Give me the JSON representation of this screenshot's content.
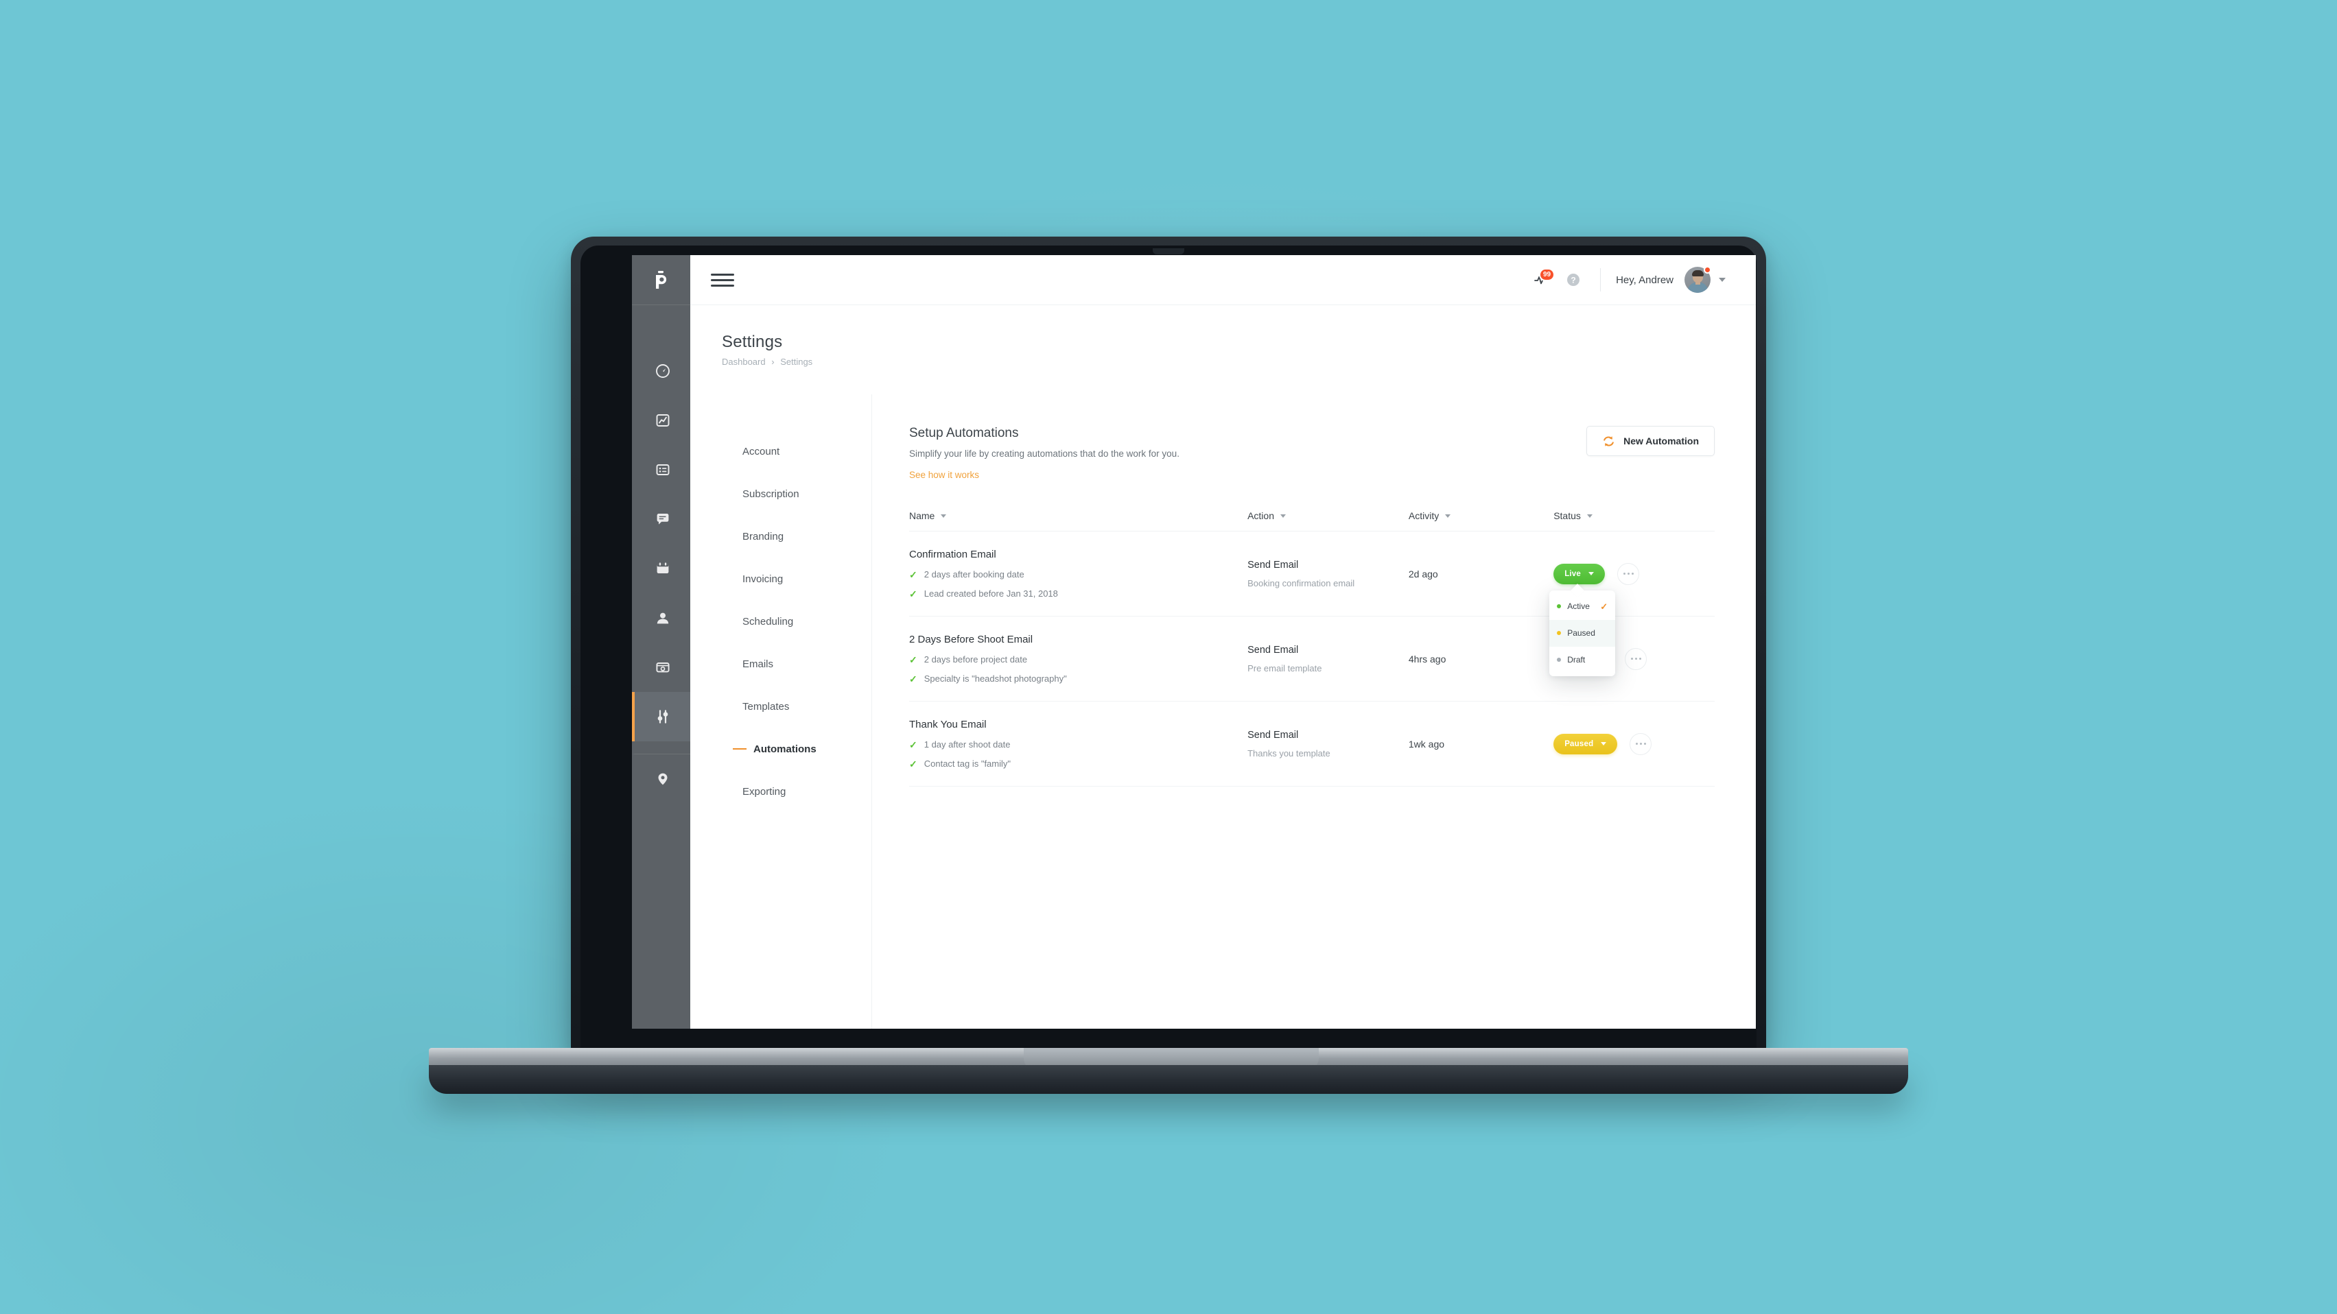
{
  "background_color": "#6EC6D4",
  "accent_color": "#F0912E",
  "app": {
    "rail": {
      "logo_icon": "pixieset-p-logo-icon",
      "items": [
        {
          "icon": "speedometer-icon",
          "name": "dashboard",
          "active": false
        },
        {
          "icon": "line-chart-icon",
          "name": "analytics",
          "active": false
        },
        {
          "icon": "list-checklist-icon",
          "name": "projects",
          "active": false
        },
        {
          "icon": "chat-bubble-icon",
          "name": "messages",
          "active": false
        },
        {
          "icon": "calendar-icon",
          "name": "calendar",
          "active": false
        },
        {
          "icon": "user-contact-icon",
          "name": "contacts",
          "active": false
        },
        {
          "icon": "browser-window-icon",
          "name": "gallery",
          "active": false
        },
        {
          "icon": "sliders-icon",
          "name": "settings",
          "active": true
        },
        {
          "icon": "location-pin-icon",
          "name": "locations",
          "active": false
        }
      ]
    },
    "topbar": {
      "menu_icon": "hamburger-menu-icon",
      "activity_icon": "activity-pulse-icon",
      "notification_count": "99",
      "help_icon": "question-mark-help-icon",
      "greeting": "Hey, Andrew",
      "avatar_icon": "user-avatar",
      "chevron_icon": "chevron-down-icon"
    },
    "page": {
      "title": "Settings",
      "breadcrumb": {
        "root": "Dashboard",
        "separator": "›",
        "current": "Settings"
      }
    },
    "settings_nav": {
      "items": [
        {
          "label": "Account",
          "active": false
        },
        {
          "label": "Subscription",
          "active": false
        },
        {
          "label": "Branding",
          "active": false
        },
        {
          "label": "Invoicing",
          "active": false
        },
        {
          "label": "Scheduling",
          "active": false
        },
        {
          "label": "Emails",
          "active": false
        },
        {
          "label": "Templates",
          "active": false
        },
        {
          "label": "Automations",
          "active": true
        },
        {
          "label": "Exporting",
          "active": false
        }
      ]
    },
    "section": {
      "title": "Setup Automations",
      "subtitle": "Simplify your life by creating automations that do the work for you.",
      "link": "See how it works",
      "new_button": {
        "label": "New Automation",
        "icon": "refresh-cycle-icon",
        "icon_color": "#F0912E"
      }
    },
    "table": {
      "columns": [
        {
          "label": "Name",
          "sort_icon": "caret-down-icon"
        },
        {
          "label": "Action",
          "sort_icon": "caret-down-icon"
        },
        {
          "label": "Activity",
          "sort_icon": "caret-down-icon"
        },
        {
          "label": "Status",
          "sort_icon": "caret-down-icon"
        }
      ],
      "rows": [
        {
          "name": "Confirmation Email",
          "conditions": [
            "2 days after booking date",
            "Lead created before Jan 31, 2018"
          ],
          "action_main": "Send Email",
          "action_sub": "Booking confirmation email",
          "activity": "2d ago",
          "status_label": "Live",
          "status_kind": "live",
          "status_color": "#4FBE34",
          "menu_icon": "more-options-icon"
        },
        {
          "name": "2 Days Before Shoot Email",
          "conditions": [
            "2 days before project date",
            "Specialty is \"headshot photography\""
          ],
          "action_main": "Send Email",
          "action_sub": "Pre email template",
          "activity": "4hrs ago",
          "status_label": "",
          "status_kind": "hidden",
          "status_color": "",
          "menu_icon": "more-options-icon"
        },
        {
          "name": "Thank You Email",
          "conditions": [
            "1 day after shoot date",
            "Contact tag is \"family\""
          ],
          "action_main": "Send Email",
          "action_sub": "Thanks you template",
          "activity": "1wk ago",
          "status_label": "Paused",
          "status_kind": "paused",
          "status_color": "#E9C21B",
          "menu_icon": "more-options-icon"
        }
      ]
    },
    "status_dropdown": {
      "open_on_row": 0,
      "options": [
        {
          "label": "Active",
          "dot_color": "#5BC236",
          "selected": true,
          "hovered": false,
          "check_icon": "checkmark-icon"
        },
        {
          "label": "Paused",
          "dot_color": "#F2C320",
          "selected": false,
          "hovered": true
        },
        {
          "label": "Draft",
          "dot_color": "#A7AFB6",
          "selected": false,
          "hovered": false
        }
      ]
    }
  }
}
